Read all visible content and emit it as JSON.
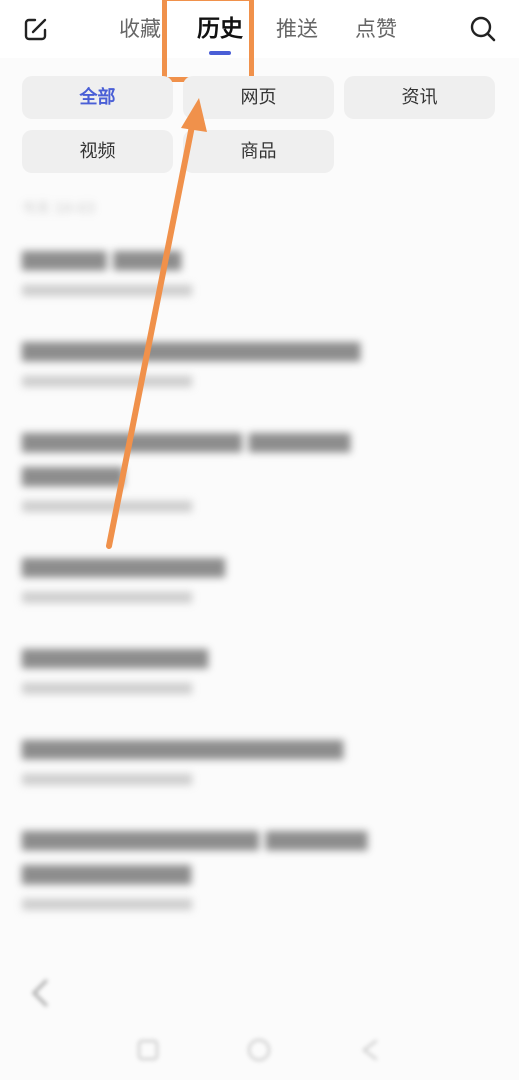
{
  "header": {
    "tabs": [
      {
        "label": "收藏"
      },
      {
        "label": "历史"
      },
      {
        "label": "推送"
      },
      {
        "label": "点赞"
      }
    ],
    "active_tab": "历史",
    "accent_color": "#4a5fd6",
    "icons": {
      "edit": "edit-icon",
      "search": "search-icon"
    }
  },
  "filters": {
    "chips": [
      {
        "label": "全部"
      },
      {
        "label": "网页"
      },
      {
        "label": "资讯"
      },
      {
        "label": "视频"
      },
      {
        "label": "商品"
      }
    ],
    "selected": "全部"
  },
  "history": {
    "date_label": "今天  10-03"
  },
  "annotation": {
    "highlight_color": "#f0914b"
  }
}
